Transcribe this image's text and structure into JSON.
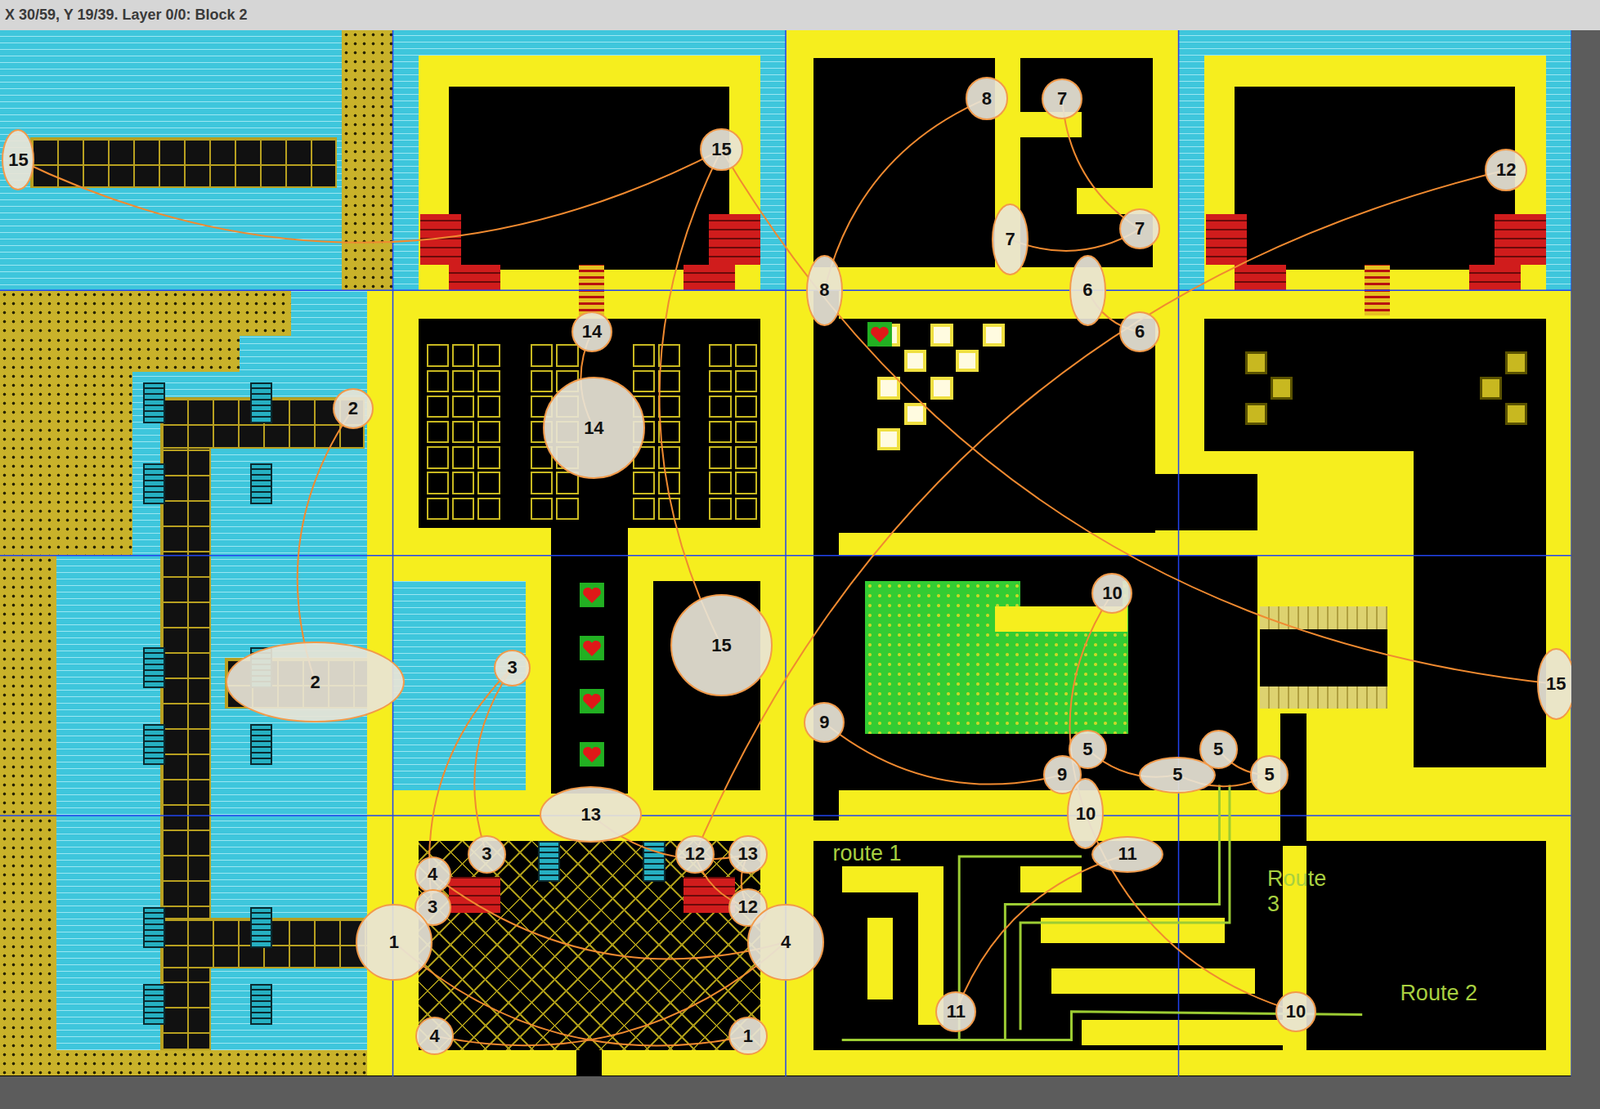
{
  "window": {
    "title": "X 30/59, Y 19/39. Layer 0/0: Block 2"
  },
  "markers": [
    {
      "label": "15"
    },
    {
      "label": "15"
    },
    {
      "label": "8"
    },
    {
      "label": "7"
    },
    {
      "label": "7"
    },
    {
      "label": "7"
    },
    {
      "label": "8"
    },
    {
      "label": "6"
    },
    {
      "label": "6"
    },
    {
      "label": "12"
    },
    {
      "label": "14"
    },
    {
      "label": "14"
    },
    {
      "label": "2"
    },
    {
      "label": "2"
    },
    {
      "label": "3"
    },
    {
      "label": "15"
    },
    {
      "label": "10"
    },
    {
      "label": "15"
    },
    {
      "label": "9"
    },
    {
      "label": "5"
    },
    {
      "label": "5"
    },
    {
      "label": "9"
    },
    {
      "label": "5"
    },
    {
      "label": "5"
    },
    {
      "label": "13"
    },
    {
      "label": "10"
    },
    {
      "label": "3"
    },
    {
      "label": "12"
    },
    {
      "label": "13"
    },
    {
      "label": "11"
    },
    {
      "label": "4"
    },
    {
      "label": "3"
    },
    {
      "label": "12"
    },
    {
      "label": "1"
    },
    {
      "label": "4"
    },
    {
      "label": "11"
    },
    {
      "label": "10"
    },
    {
      "label": "4"
    },
    {
      "label": "1"
    }
  ],
  "links": [
    [
      0,
      1
    ],
    [
      1,
      15
    ],
    [
      1,
      17
    ],
    [
      2,
      6
    ],
    [
      3,
      5
    ],
    [
      4,
      5
    ],
    [
      7,
      8
    ],
    [
      9,
      27
    ],
    [
      10,
      11
    ],
    [
      12,
      13
    ],
    [
      14,
      26
    ],
    [
      14,
      31
    ],
    [
      24,
      28
    ],
    [
      33,
      38
    ],
    [
      30,
      34
    ],
    [
      37,
      34
    ],
    [
      19,
      22
    ],
    [
      20,
      23
    ],
    [
      18,
      21
    ],
    [
      16,
      25
    ],
    [
      25,
      36
    ],
    [
      29,
      35
    ],
    [
      27,
      32
    ],
    [
      28,
      32
    ],
    [
      22,
      23
    ]
  ],
  "routes": [
    {
      "label": "route 1"
    },
    {
      "label": "Route 3"
    },
    {
      "label": "Route 2"
    }
  ]
}
